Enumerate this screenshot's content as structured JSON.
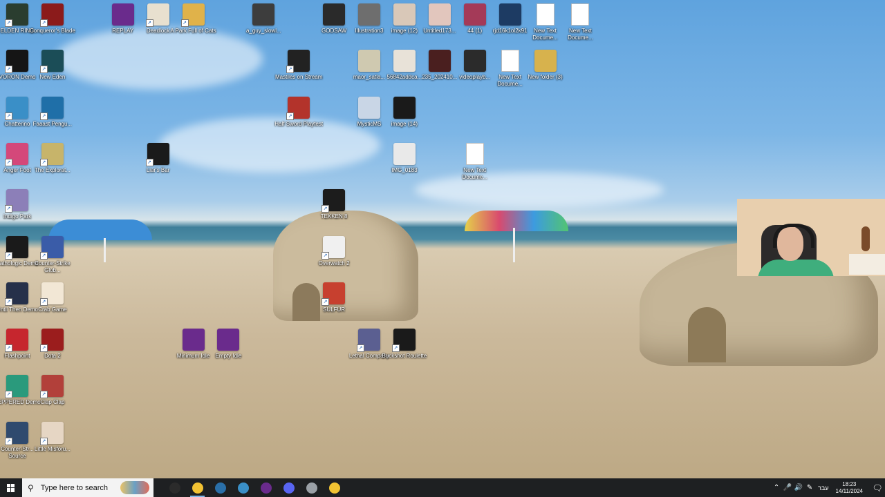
{
  "desktop_icons": [
    {
      "label": "ELDEN RING",
      "color": "#2a3d2f",
      "shortcut": true
    },
    {
      "label": "Conqueror's Blade",
      "color": "#8b1b1b",
      "shortcut": true
    },
    {
      "label": "REPLAY",
      "color": "#6a2b8c",
      "shortcut": false
    },
    {
      "label": "Deadlock",
      "color": "#e8e0cf",
      "shortcut": true
    },
    {
      "label": "A Park Full of Cats",
      "color": "#e0b24a",
      "shortcut": true
    },
    {
      "label": "a_guy_slowl...",
      "color": "#3d3d3d",
      "shortcut": false
    },
    {
      "label": "GODSAW",
      "color": "#2a2a2a",
      "shortcut": false
    },
    {
      "label": "Illustration3",
      "color": "#6e6e6e",
      "shortcut": false
    },
    {
      "label": "image (12)",
      "color": "#d9c8b8",
      "shortcut": false
    },
    {
      "label": "Untitled173...",
      "color": "#e2c6bd",
      "shortcut": false
    },
    {
      "label": "44 (1)",
      "color": "#a43a58",
      "shortcut": false
    },
    {
      "label": "rjd16k1ol2k91",
      "color": "#1d3b63",
      "shortcut": false
    },
    {
      "label": "New Text Docume...",
      "color": "#ffffff",
      "shortcut": false,
      "doc": true
    },
    {
      "label": "New Text Docume...",
      "color": "#ffffff",
      "shortcut": false,
      "doc": true
    },
    {
      "label": "VORON Demo",
      "color": "#151515",
      "shortcut": true
    },
    {
      "label": "New Eden",
      "color": "#1b4d57",
      "shortcut": true
    },
    {
      "label": "Mastiles on Stream",
      "color": "#222222",
      "shortcut": true
    },
    {
      "label": "maor_satla...",
      "color": "#cfc9b0",
      "shortcut": false
    },
    {
      "label": "56842addca...",
      "color": "#e8e2d8",
      "shortcut": false
    },
    {
      "label": "235_202410...",
      "color": "#4a1f1f",
      "shortcut": false
    },
    {
      "label": "videoplayb...",
      "color": "#2b2b2b",
      "shortcut": false
    },
    {
      "label": "New Text Docume...",
      "color": "#ffffff",
      "shortcut": false,
      "doc": true
    },
    {
      "label": "New folder (3)",
      "color": "#d7b24d",
      "shortcut": false
    },
    {
      "label": "Chatterino",
      "color": "#3a8fc7",
      "shortcut": true
    },
    {
      "label": "Faaast Pengu...",
      "color": "#1f6fa8",
      "shortcut": true
    },
    {
      "label": "Half Sword Playtest",
      "color": "#b3332b",
      "shortcut": true
    },
    {
      "label": "MysticMS",
      "color": "#c9d6e6",
      "shortcut": false
    },
    {
      "label": "image (14)",
      "color": "#1a1a1a",
      "shortcut": false
    },
    {
      "label": "Anger Foot",
      "color": "#d4487a",
      "shortcut": true
    },
    {
      "label": "The Explorat...",
      "color": "#c7b46a",
      "shortcut": true
    },
    {
      "label": "Liar's Bar",
      "color": "#1a1a1a",
      "shortcut": true
    },
    {
      "label": "IMG_0183",
      "color": "#e9e9e9",
      "shortcut": false
    },
    {
      "label": "New Text Docume...",
      "color": "#ffffff",
      "shortcut": false,
      "doc": true
    },
    {
      "label": "Indigo Park",
      "color": "#8c7fb8",
      "shortcut": true
    },
    {
      "label": "TEKKEN 8",
      "color": "#1c1c1c",
      "shortcut": true
    },
    {
      "label": "Pathologic Demo",
      "color": "#1a1a1a",
      "shortcut": true
    },
    {
      "label": "Counter-Strike Glob...",
      "color": "#3a5ca8",
      "shortcut": true
    },
    {
      "label": "Overwatch 2",
      "color": "#f0f0f0",
      "shortcut": true
    },
    {
      "label": "Until Then Demo",
      "color": "#26304a",
      "shortcut": true
    },
    {
      "label": "Crab Game",
      "color": "#f2e7d5",
      "shortcut": true
    },
    {
      "label": "SULFUR",
      "color": "#c7402f",
      "shortcut": true
    },
    {
      "label": "Flashpoint",
      "color": "#c6262e",
      "shortcut": true
    },
    {
      "label": "Dota 2",
      "color": "#9b1d1d",
      "shortcut": true
    },
    {
      "label": "Minimum Idle",
      "color": "#6a2b8c",
      "shortcut": false
    },
    {
      "label": "Empty Idle",
      "color": "#6a2b8c",
      "shortcut": false
    },
    {
      "label": "Lethal Company",
      "color": "#5b5f91",
      "shortcut": true
    },
    {
      "label": "Buckshot Roulette",
      "color": "#1a1a1a",
      "shortcut": true
    },
    {
      "label": "PEPPERED Demo",
      "color": "#2a9a7c",
      "shortcut": true
    },
    {
      "label": "Clap Clap",
      "color": "#b2403a",
      "shortcut": true
    },
    {
      "label": "Counter-Str... Source",
      "color": "#2f4a6e",
      "shortcut": true
    },
    {
      "label": "Little Misforu...",
      "color": "#e6d6c4",
      "shortcut": true
    }
  ],
  "taskbar": {
    "search_placeholder": "Type here to search",
    "apps": [
      {
        "name": "obs-icon",
        "color": "#2b2b2b"
      },
      {
        "name": "chrome-icon",
        "color": "#f2c233"
      },
      {
        "name": "steam-icon",
        "color": "#2a6fa8"
      },
      {
        "name": "chatterino-icon",
        "color": "#3a8fc7"
      },
      {
        "name": "winrar-icon",
        "color": "#6a2b8c"
      },
      {
        "name": "discord-icon",
        "color": "#5865f2"
      },
      {
        "name": "security-icon",
        "color": "#9aa0a6"
      },
      {
        "name": "file-explorer-icon",
        "color": "#f1c232"
      }
    ],
    "language": "עבר",
    "time": "18:23",
    "date": "14/11/2024"
  }
}
